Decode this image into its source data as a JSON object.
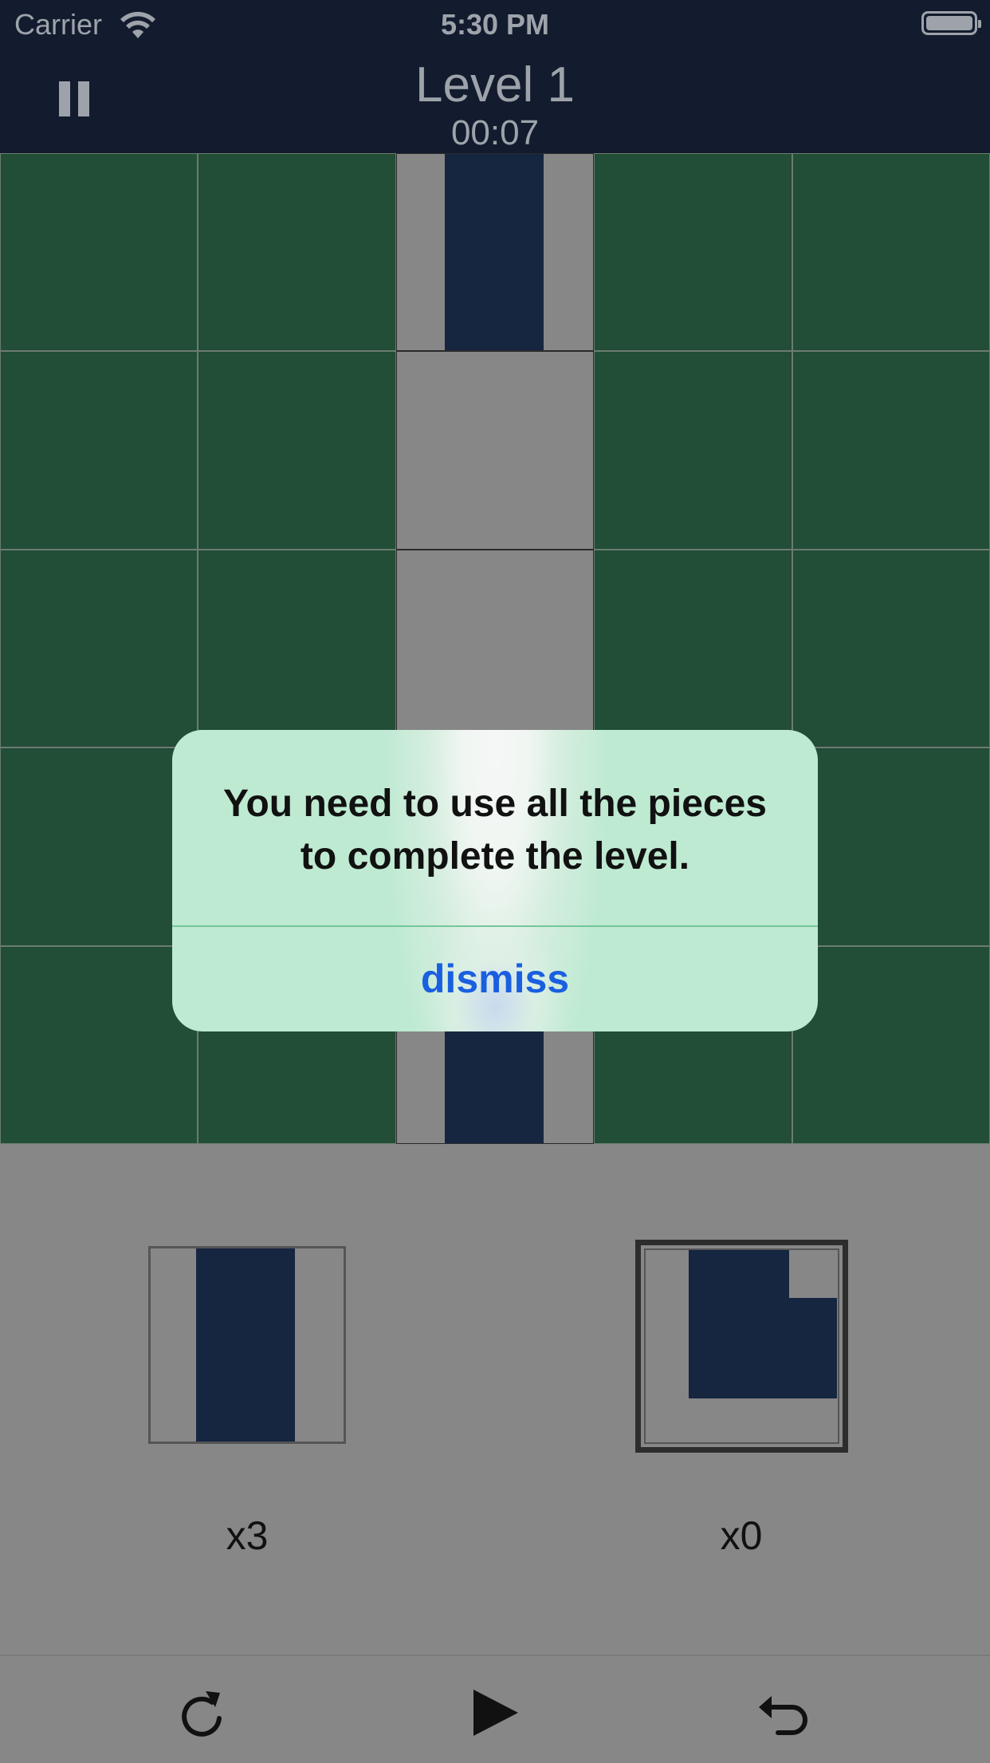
{
  "status_bar": {
    "carrier": "Carrier",
    "time": "5:30 PM"
  },
  "header": {
    "level_title": "Level 1",
    "timer": "00:07"
  },
  "board": {
    "rows": 5,
    "cols": 5,
    "cells": [
      [
        "green",
        "green",
        "pipe-vertical",
        "green",
        "green"
      ],
      [
        "green",
        "green",
        "empty",
        "green",
        "green"
      ],
      [
        "green",
        "green",
        "empty",
        "green",
        "green"
      ],
      [
        "green",
        "green",
        "empty",
        "green",
        "green"
      ],
      [
        "green",
        "green",
        "pipe-vertical",
        "green",
        "green"
      ]
    ]
  },
  "pieces": [
    {
      "type": "straight-vertical",
      "count_label": "x3"
    },
    {
      "type": "corner",
      "count_label": "x0",
      "selected": true
    }
  ],
  "toolbar": {
    "redo_icon": "redo-icon",
    "play_icon": "play-icon",
    "undo_icon": "undo-icon"
  },
  "alert": {
    "message": "You need to use all the pieces to complete the level.",
    "button_label": "dismiss"
  },
  "colors": {
    "header_bg": "#131c2e",
    "tile_green": "#224d36",
    "tile_gray": "#878787",
    "pipe": "#162641",
    "alert_bg": "#bfead2",
    "alert_button_text": "#1a5fe0"
  }
}
